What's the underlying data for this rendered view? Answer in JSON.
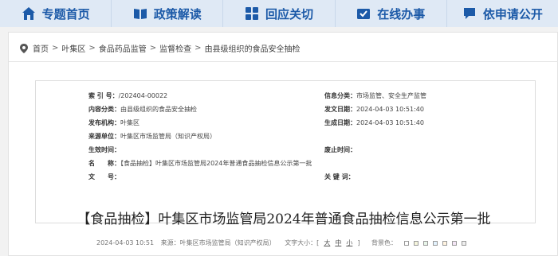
{
  "nav": [
    {
      "label": "专题首页",
      "icon": "home-icon"
    },
    {
      "label": "政策解读",
      "icon": "book-icon"
    },
    {
      "label": "回应关切",
      "icon": "grid-icon"
    },
    {
      "label": "在线办事",
      "icon": "checkbox-icon"
    },
    {
      "label": "依申请公开",
      "icon": "chat-icon"
    }
  ],
  "breadcrumb": [
    "首页",
    "叶集区",
    "食品药品监管",
    "监督检查",
    "由县级组织的食品安全抽检"
  ],
  "breadcrumb_sep": ">",
  "info": {
    "index_label": "索 引 号：",
    "index_value": "/202404-00022",
    "category_label": "信息分类：",
    "category_value": "市场监管、安全生产监管",
    "content_label": "内容分类：",
    "content_value": "由县级组织的食品安全抽检",
    "release_date_label": "发文日期：",
    "release_date_value": "2024-04-03 10:51:40",
    "issuer_label": "发布机构：",
    "issuer_value": "叶集区",
    "generated_label": "生成日期：",
    "generated_value": "2024-04-03 10:51:40",
    "source_label": "来源单位：",
    "source_value": "叶集区市场监管局（知识产权局）",
    "effective_label": "生效时间：",
    "effective_value": "",
    "abolish_label": "废止时间：",
    "abolish_value": "",
    "name_label": "名　　称：",
    "name_value": "【食品抽检】叶集区市场监管局2024年普通食品抽检信息公示第一批",
    "doc_no_label": "文　　号：",
    "doc_no_value": "",
    "keywords_label": "关 键 词：",
    "keywords_value": ""
  },
  "title": "【食品抽检】叶集区市场监管局2024年普通食品抽检信息公示第一批",
  "meta": {
    "date": "2024-04-03 10:51",
    "source": "来源：叶集区市场监管局（知识产权局）",
    "font_size_label": "文字大小：[",
    "font_large": "大",
    "font_medium": "中",
    "font_small": "小",
    "font_size_end": "]",
    "bg_label": "背景色："
  },
  "colors": {
    "nav_bg": "#dfe9f5",
    "nav_text": "#1c5aa8",
    "bg_swatches": [
      "#ffffff",
      "#f5f5dc",
      "#e8f5e9",
      "#e3f2fd",
      "#fff3e0",
      "#f3e5f5",
      "#eeeeee"
    ]
  }
}
